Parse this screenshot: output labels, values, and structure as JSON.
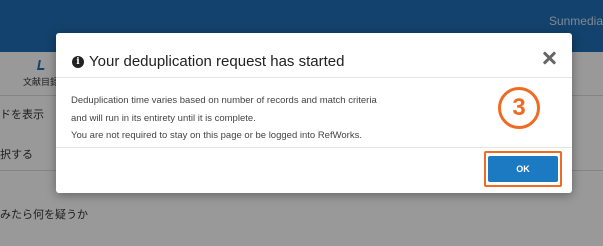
{
  "app": {
    "brand": "Sunmedia",
    "nav": {
      "label": "文献目録"
    },
    "side_lines": [
      "ドを表示",
      "択する",
      "みたら何を疑うか"
    ]
  },
  "modal": {
    "icon": "info-circle-icon",
    "title": "Your deduplication request has started",
    "close_icon": "close-icon",
    "body_lines": [
      "Deduplication time varies based on number of records and match criteria",
      "and will run in its entirety until it is complete.",
      "You are not required to stay on this page or be logged into RefWorks."
    ],
    "ok_label": "OK"
  },
  "annotation": {
    "step": "3",
    "color": "#ef6a22"
  },
  "colors": {
    "accent": "#1f6fb6",
    "button": "#1b7ac2"
  }
}
